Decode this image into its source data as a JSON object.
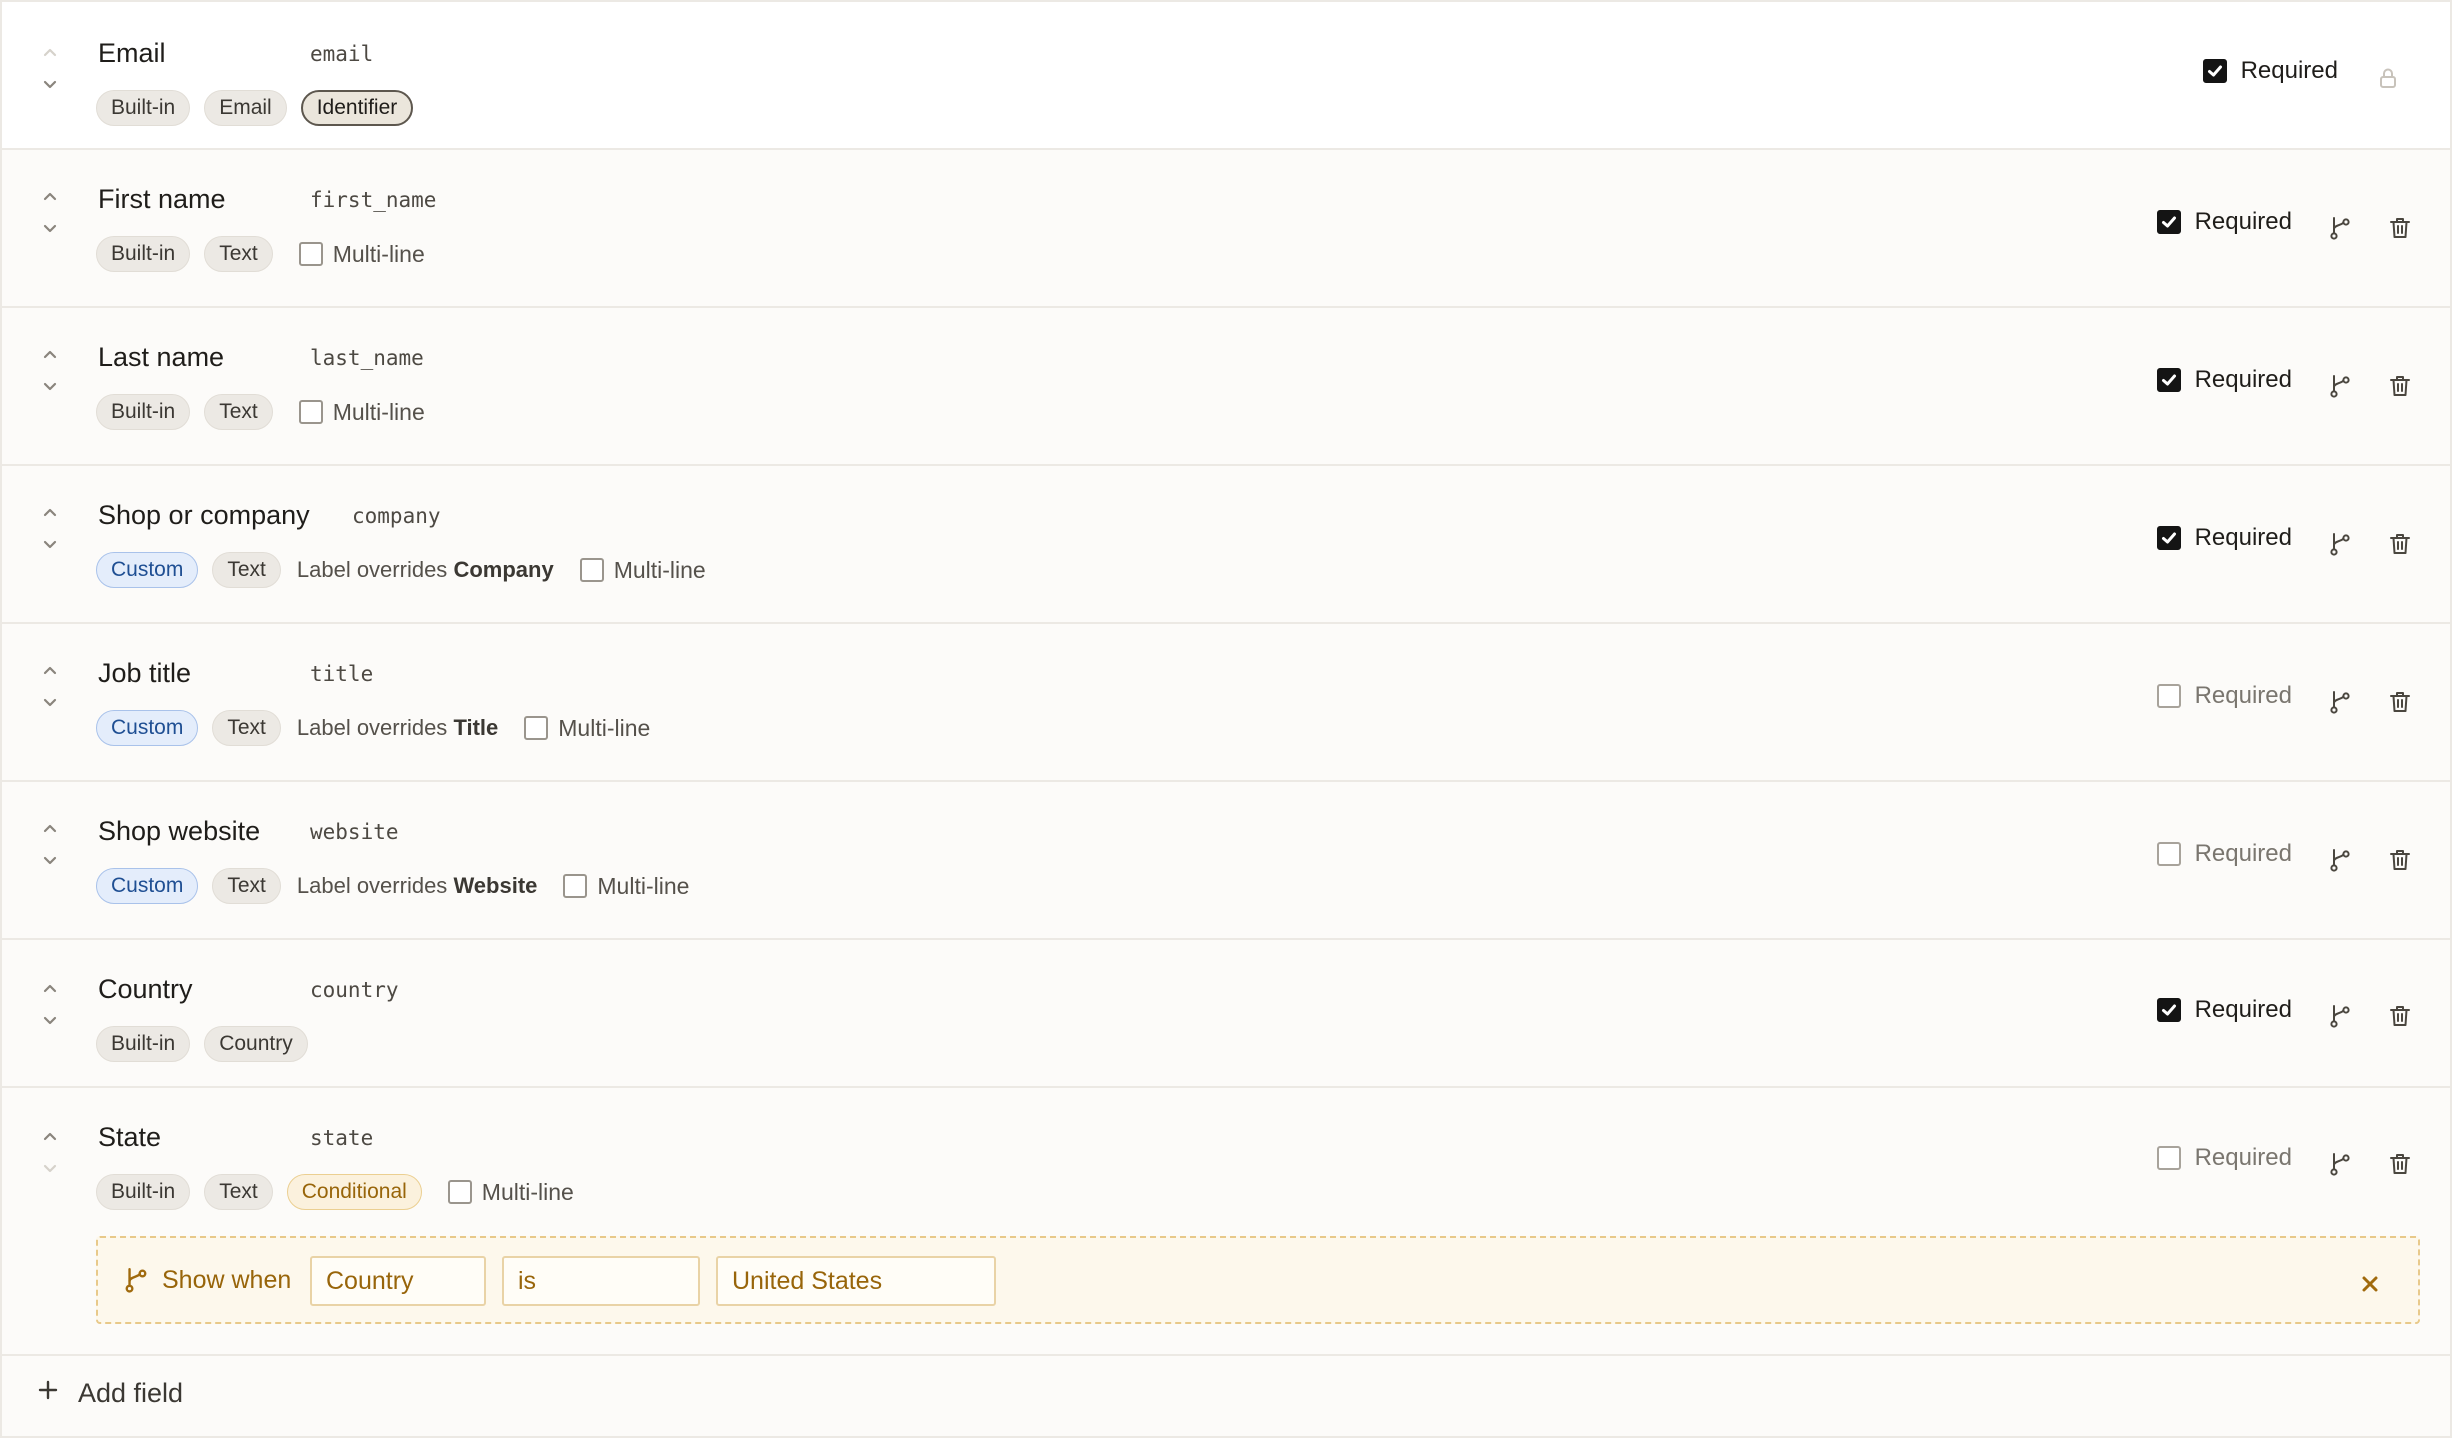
{
  "fields": [
    {
      "label": "Email",
      "key": "email",
      "tags": [
        "Built-in",
        "Email",
        "Identifier"
      ],
      "required_label": "Required",
      "required": true
    },
    {
      "label": "First name",
      "key": "first_name",
      "tags": [
        "Built-in",
        "Text"
      ],
      "multiline_label": "Multi-line",
      "required_label": "Required",
      "required": true
    },
    {
      "label": "Last name",
      "key": "last_name",
      "tags": [
        "Built-in",
        "Text"
      ],
      "multiline_label": "Multi-line",
      "required_label": "Required",
      "required": true
    },
    {
      "label": "Shop or company",
      "key": "company",
      "tags": [
        "Custom",
        "Text"
      ],
      "override_prefix": "Label overrides",
      "override_value": "Company",
      "multiline_label": "Multi-line",
      "required_label": "Required",
      "required": true
    },
    {
      "label": "Job title",
      "key": "title",
      "tags": [
        "Custom",
        "Text"
      ],
      "override_prefix": "Label overrides",
      "override_value": "Title",
      "multiline_label": "Multi-line",
      "required_label": "Required",
      "required": false
    },
    {
      "label": "Shop website",
      "key": "website",
      "tags": [
        "Custom",
        "Text"
      ],
      "override_prefix": "Label overrides",
      "override_value": "Website",
      "multiline_label": "Multi-line",
      "required_label": "Required",
      "required": false
    },
    {
      "label": "Country",
      "key": "country",
      "tags": [
        "Built-in",
        "Country"
      ],
      "required_label": "Required",
      "required": true
    },
    {
      "label": "State",
      "key": "state",
      "tags": [
        "Built-in",
        "Text",
        "Conditional"
      ],
      "multiline_label": "Multi-line",
      "required_label": "Required",
      "required": false
    }
  ],
  "condition": {
    "show_when_label": "Show when",
    "field": "Country",
    "operator": "is",
    "value": "United States"
  },
  "add_field_label": "Add field",
  "icons": {
    "reorder_up": "chevron-up-icon",
    "reorder_down": "chevron-down-icon",
    "lock": "lock-icon",
    "condition": "branch-icon",
    "delete": "trash-icon",
    "close": "close-icon",
    "add": "plus-icon"
  },
  "colors": {
    "custom_tag": "#1f4f93",
    "conditional_tag": "#98650a",
    "condition_box_bg": "#fdf8ec",
    "checkbox_checked": "#141414"
  }
}
